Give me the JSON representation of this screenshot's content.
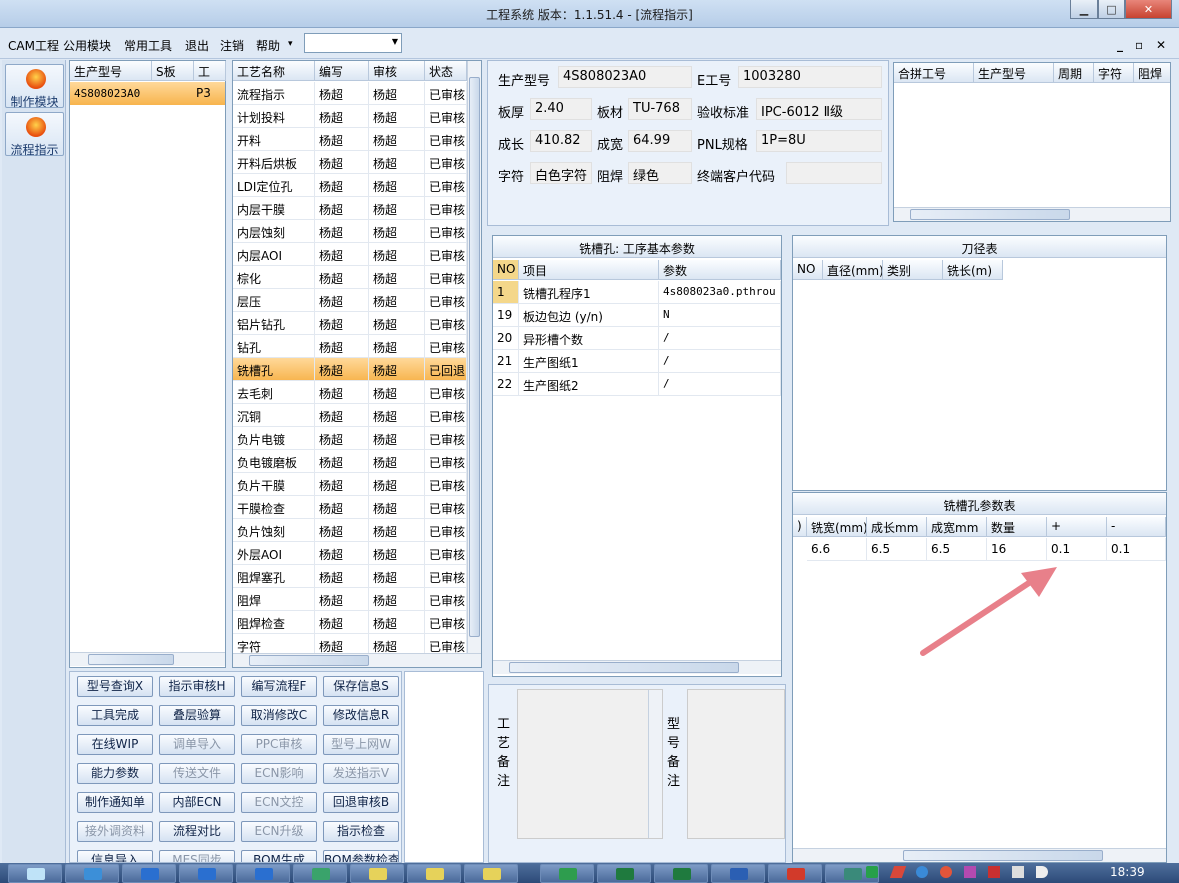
{
  "window": {
    "title": "工程系统   版本：1.1.51.4 - [流程指示]"
  },
  "menu": [
    "CAM工程",
    "公用模块",
    "常用工具",
    "退出",
    "注销",
    "帮助"
  ],
  "menu_more": "▾",
  "sidebar": {
    "items": [
      {
        "label": "制作模块"
      },
      {
        "label": "流程指示"
      }
    ]
  },
  "orders": {
    "headers": [
      "生产型号",
      "S板",
      "工"
    ],
    "rows": [
      [
        "4S808023A0",
        "",
        "P3"
      ]
    ]
  },
  "process": {
    "headers": [
      "工艺名称",
      "编写",
      "审核",
      "状态"
    ],
    "rows": [
      [
        "流程指示",
        "杨超",
        "杨超",
        "已审核"
      ],
      [
        "计划投料",
        "杨超",
        "杨超",
        "已审核"
      ],
      [
        "开料",
        "杨超",
        "杨超",
        "已审核"
      ],
      [
        "开料后烘板",
        "杨超",
        "杨超",
        "已审核"
      ],
      [
        "LDI定位孔",
        "杨超",
        "杨超",
        "已审核"
      ],
      [
        "内层干膜",
        "杨超",
        "杨超",
        "已审核"
      ],
      [
        "内层蚀刻",
        "杨超",
        "杨超",
        "已审核"
      ],
      [
        "内层AOI",
        "杨超",
        "杨超",
        "已审核"
      ],
      [
        "棕化",
        "杨超",
        "杨超",
        "已审核"
      ],
      [
        "层压",
        "杨超",
        "杨超",
        "已审核"
      ],
      [
        "铝片钻孔",
        "杨超",
        "杨超",
        "已审核"
      ],
      [
        "钻孔",
        "杨超",
        "杨超",
        "已审核"
      ],
      [
        "铣槽孔",
        "杨超",
        "杨超",
        "已回退"
      ],
      [
        "去毛刺",
        "杨超",
        "杨超",
        "已审核"
      ],
      [
        "沉铜",
        "杨超",
        "杨超",
        "已审核"
      ],
      [
        "负片电镀",
        "杨超",
        "杨超",
        "已审核"
      ],
      [
        "负电镀磨板",
        "杨超",
        "杨超",
        "已审核"
      ],
      [
        "负片干膜",
        "杨超",
        "杨超",
        "已审核"
      ],
      [
        "干膜检查",
        "杨超",
        "杨超",
        "已审核"
      ],
      [
        "负片蚀刻",
        "杨超",
        "杨超",
        "已审核"
      ],
      [
        "外层AOI",
        "杨超",
        "杨超",
        "已审核"
      ],
      [
        "阻焊塞孔",
        "杨超",
        "杨超",
        "已审核"
      ],
      [
        "阻焊",
        "杨超",
        "杨超",
        "已审核"
      ],
      [
        "阻焊检查",
        "杨超",
        "杨超",
        "已审核"
      ],
      [
        "字符",
        "杨超",
        "杨超",
        "已审核"
      ]
    ],
    "selected_index": 12
  },
  "info": {
    "model_label": "生产型号",
    "model": "4S808023A0",
    "eid_label": "E工号",
    "eid": "1003280",
    "thickness_label": "板厚",
    "thickness": "2.40",
    "material_label": "板材",
    "material": "TU-768",
    "standard_label": "验收标准",
    "standard": "IPC-6012 Ⅱ级",
    "length_label": "成长",
    "length": "410.82",
    "width_label": "成宽",
    "width": "64.99",
    "pnl_label": "PNL规格",
    "pnl": "1P=8U",
    "char_label": "字符",
    "char": "白色字符",
    "mask_label": "阻焊",
    "mask": "绿色",
    "customer_label": "终端客户代码",
    "customer": ""
  },
  "combine": {
    "headers": [
      "合拼工号",
      "生产型号",
      "周期",
      "字符",
      "阻焊"
    ]
  },
  "params": {
    "title": "铣槽孔: 工序基本参数",
    "headers": [
      "NO",
      "项目",
      "参数"
    ],
    "rows": [
      [
        "1",
        "铣槽孔程序1",
        "4s808023a0.pthrou"
      ],
      [
        "19",
        "板边包边 (y/n)",
        "N"
      ],
      [
        "20",
        "异形槽个数",
        "/"
      ],
      [
        "21",
        "生产图纸1",
        "/"
      ],
      [
        "22",
        "生产图纸2",
        "/"
      ]
    ]
  },
  "tools": {
    "title": "刀径表",
    "headers": [
      "NO",
      "直径(mm)",
      "类别",
      "铣长(m)"
    ]
  },
  "slot": {
    "title": "铣槽孔参数表",
    "headers": [
      ")",
      "铣宽(mm)",
      "成长mm",
      "成宽mm",
      "数量",
      "+",
      "-"
    ],
    "rows": [
      [
        "",
        "6.6",
        "6.5",
        "6.5",
        "16",
        "0.1",
        "0.1"
      ]
    ]
  },
  "buttons": [
    {
      "label": "型号查询X",
      "enabled": true
    },
    {
      "label": "指示审核H",
      "enabled": true
    },
    {
      "label": "编写流程F",
      "enabled": true
    },
    {
      "label": "保存信息S",
      "enabled": true
    },
    {
      "label": "工具完成",
      "enabled": true
    },
    {
      "label": "叠层验算",
      "enabled": true
    },
    {
      "label": "取消修改C",
      "enabled": true
    },
    {
      "label": "修改信息R",
      "enabled": true
    },
    {
      "label": "在线WIP",
      "enabled": true
    },
    {
      "label": "调单导入",
      "enabled": false
    },
    {
      "label": "PPC审核",
      "enabled": false
    },
    {
      "label": "型号上网W",
      "enabled": false
    },
    {
      "label": "能力参数",
      "enabled": true
    },
    {
      "label": "传送文件",
      "enabled": false
    },
    {
      "label": "ECN影响",
      "enabled": false
    },
    {
      "label": "发送指示V",
      "enabled": false
    },
    {
      "label": "制作通知单",
      "enabled": true
    },
    {
      "label": "内部ECN",
      "enabled": true
    },
    {
      "label": "ECN文控",
      "enabled": false
    },
    {
      "label": "回退审核B",
      "enabled": true
    },
    {
      "label": "接外调资料",
      "enabled": false
    },
    {
      "label": "流程对比",
      "enabled": true
    },
    {
      "label": "ECN升级",
      "enabled": false
    },
    {
      "label": "指示检查",
      "enabled": true
    },
    {
      "label": "信息导入",
      "enabled": true
    },
    {
      "label": "MES同步",
      "enabled": false
    },
    {
      "label": "BOM生成",
      "enabled": true
    },
    {
      "label": "BOM参数检查",
      "enabled": true
    }
  ],
  "notes": {
    "process_label": [
      "工",
      "艺",
      "备",
      "注"
    ],
    "model_label": [
      "型",
      "号",
      "备",
      "注"
    ]
  },
  "clock": "18:39"
}
